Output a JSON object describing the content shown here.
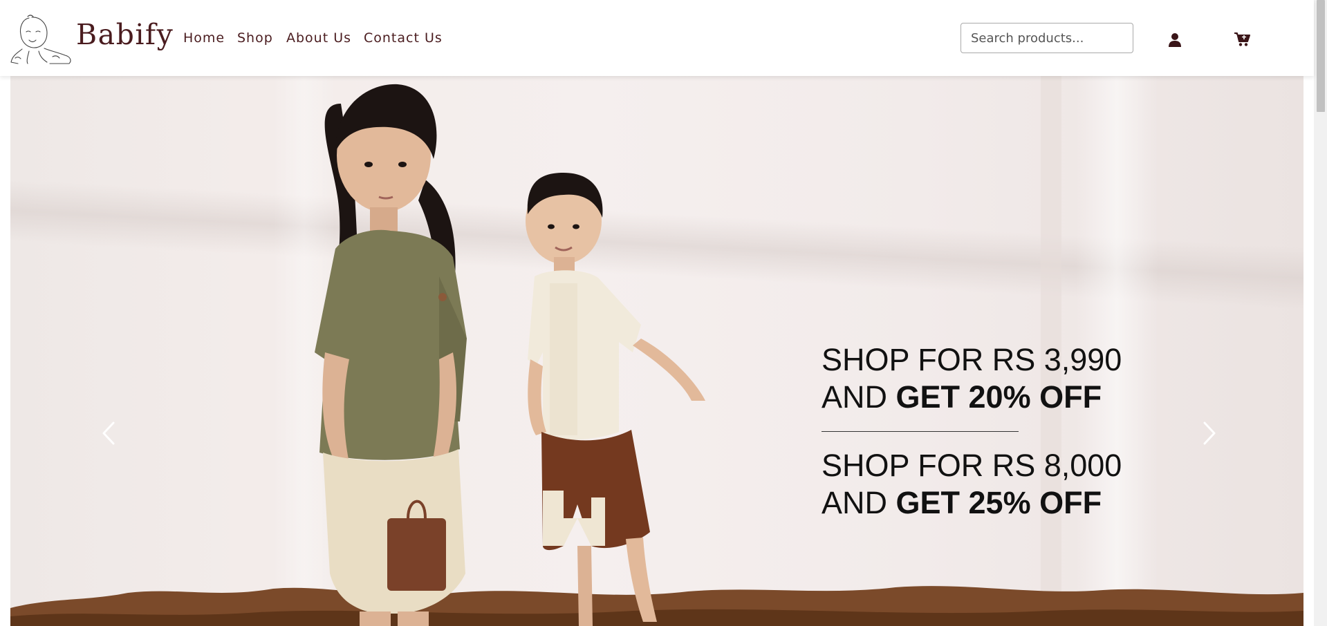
{
  "brand": {
    "name": "Babify",
    "logo": "baby-sketch-logo"
  },
  "nav": {
    "links": [
      "Home",
      "Shop",
      "About Us",
      "Contact Us"
    ]
  },
  "search": {
    "placeholder": "Search products...",
    "value": ""
  },
  "icons": {
    "account": "user-icon",
    "cart": "cart-icon",
    "prev": "chevron-left-icon",
    "next": "chevron-right-icon"
  },
  "hero": {
    "offer1_line1": "SHOP FOR RS 3,990",
    "offer1_prefix": "AND ",
    "offer1_bold": "GET 20% OFF",
    "offer2_line1": "SHOP FOR RS 8,000",
    "offer2_prefix": "AND ",
    "offer2_bold": "GET 25% OFF"
  },
  "colors": {
    "brand": "#4a1c1f",
    "text": "#111111"
  }
}
